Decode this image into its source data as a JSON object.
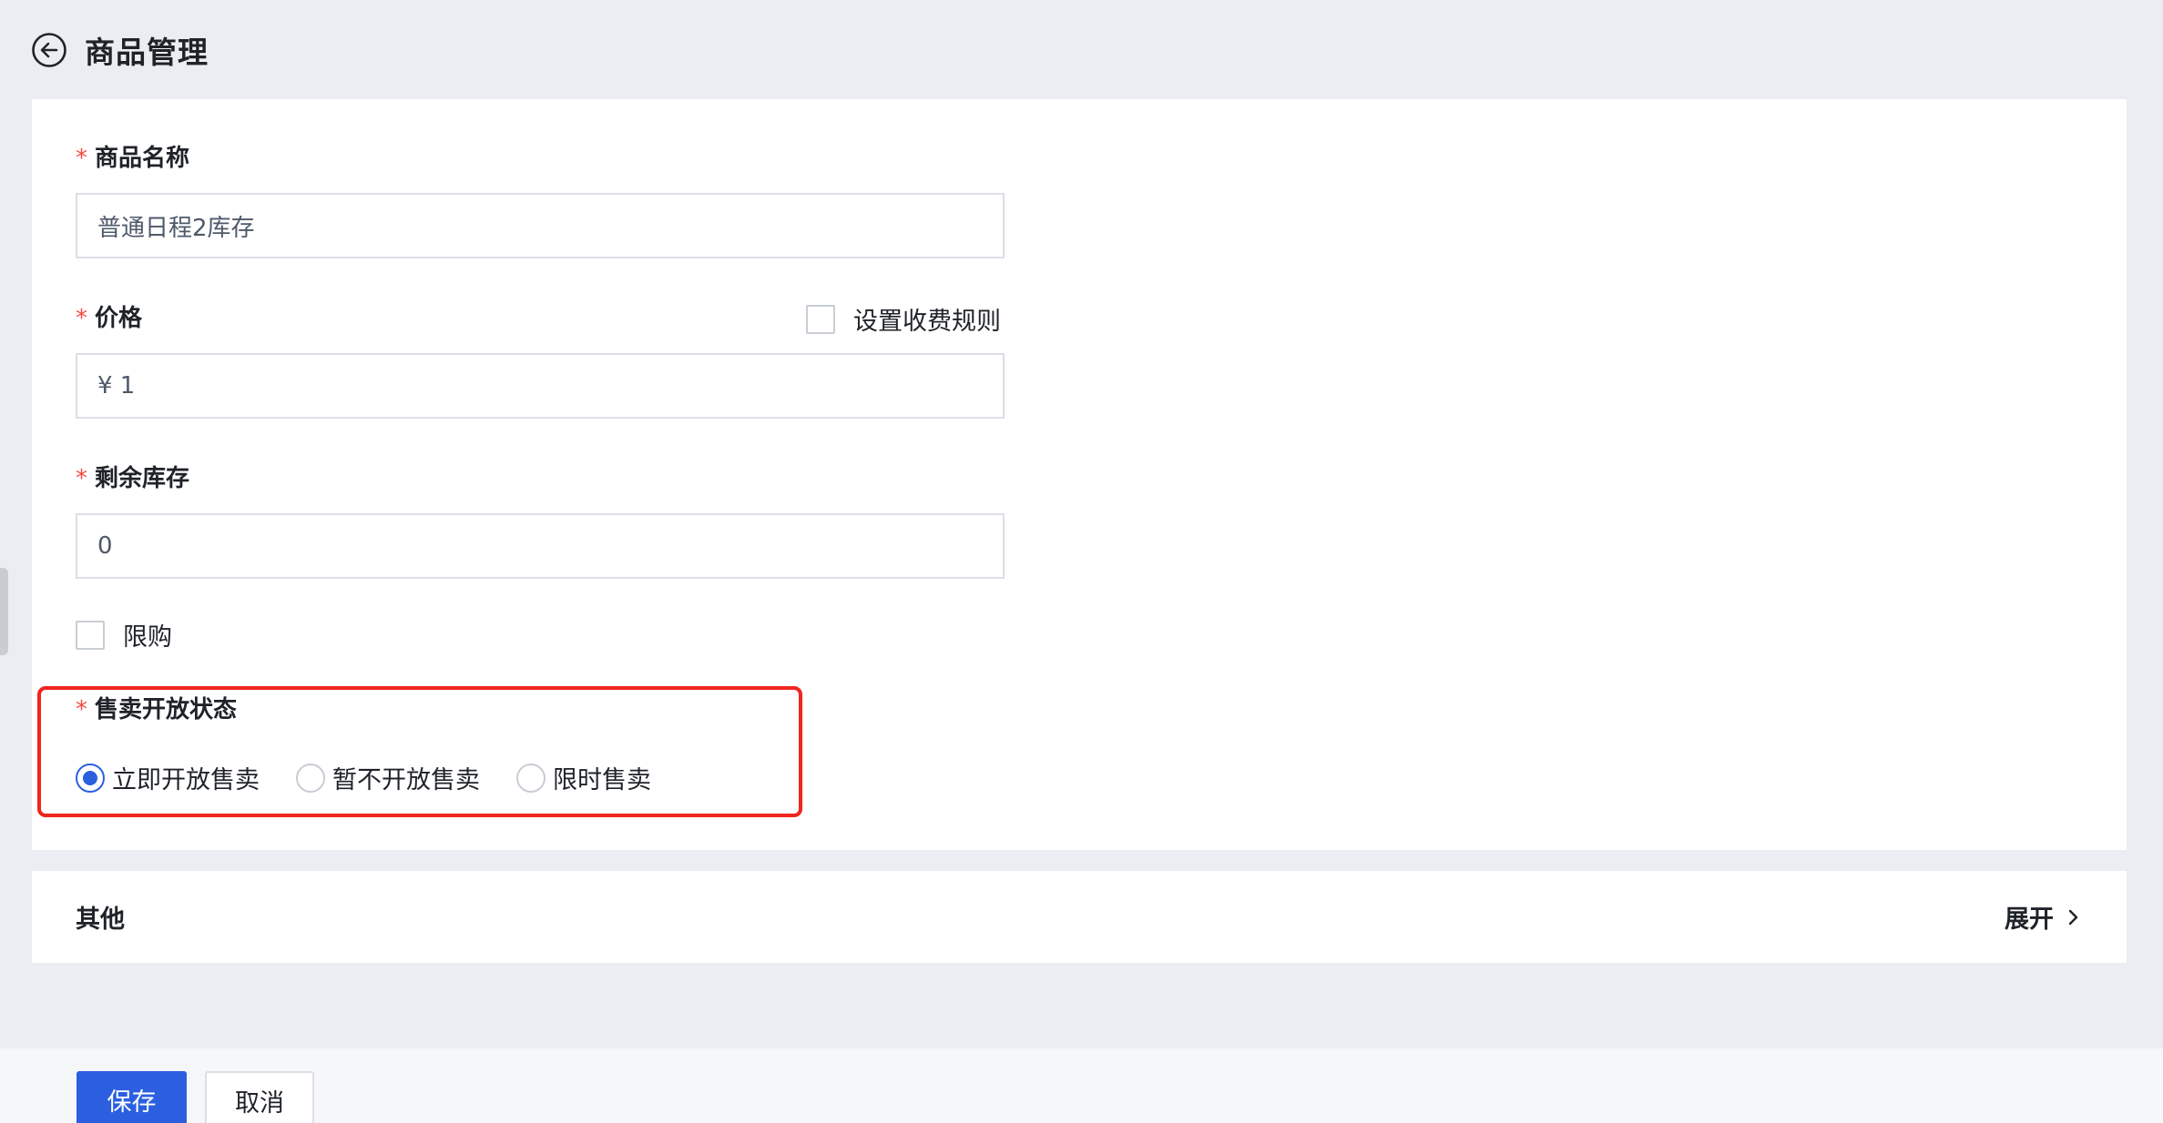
{
  "header": {
    "back_icon": "arrow-left-circle-icon",
    "title": "商品管理"
  },
  "form": {
    "name": {
      "required_mark": "*",
      "label": "商品名称",
      "value": "普通日程2库存"
    },
    "price": {
      "required_mark": "*",
      "label": "价格",
      "value": "¥ 1",
      "rule_checkbox_label": "设置收费规则",
      "rule_checkbox_checked": false
    },
    "stock": {
      "required_mark": "*",
      "label": "剩余库存",
      "value": "0"
    },
    "purchase_limit": {
      "label": "限购",
      "checked": false
    },
    "sale_status": {
      "required_mark": "*",
      "label": "售卖开放状态",
      "options": [
        {
          "label": "立即开放售卖",
          "checked": true
        },
        {
          "label": "暂不开放售卖",
          "checked": false
        },
        {
          "label": "限时售卖",
          "checked": false
        }
      ]
    }
  },
  "other": {
    "title": "其他",
    "expand_label": "展开",
    "expand_icon": "chevron-right-icon"
  },
  "footer": {
    "save_label": "保存",
    "cancel_label": "取消"
  },
  "colors": {
    "primary": "#2b5fe0",
    "required": "#f54a45",
    "highlight": "#f0251e",
    "page_bg": "#ebedf2"
  }
}
